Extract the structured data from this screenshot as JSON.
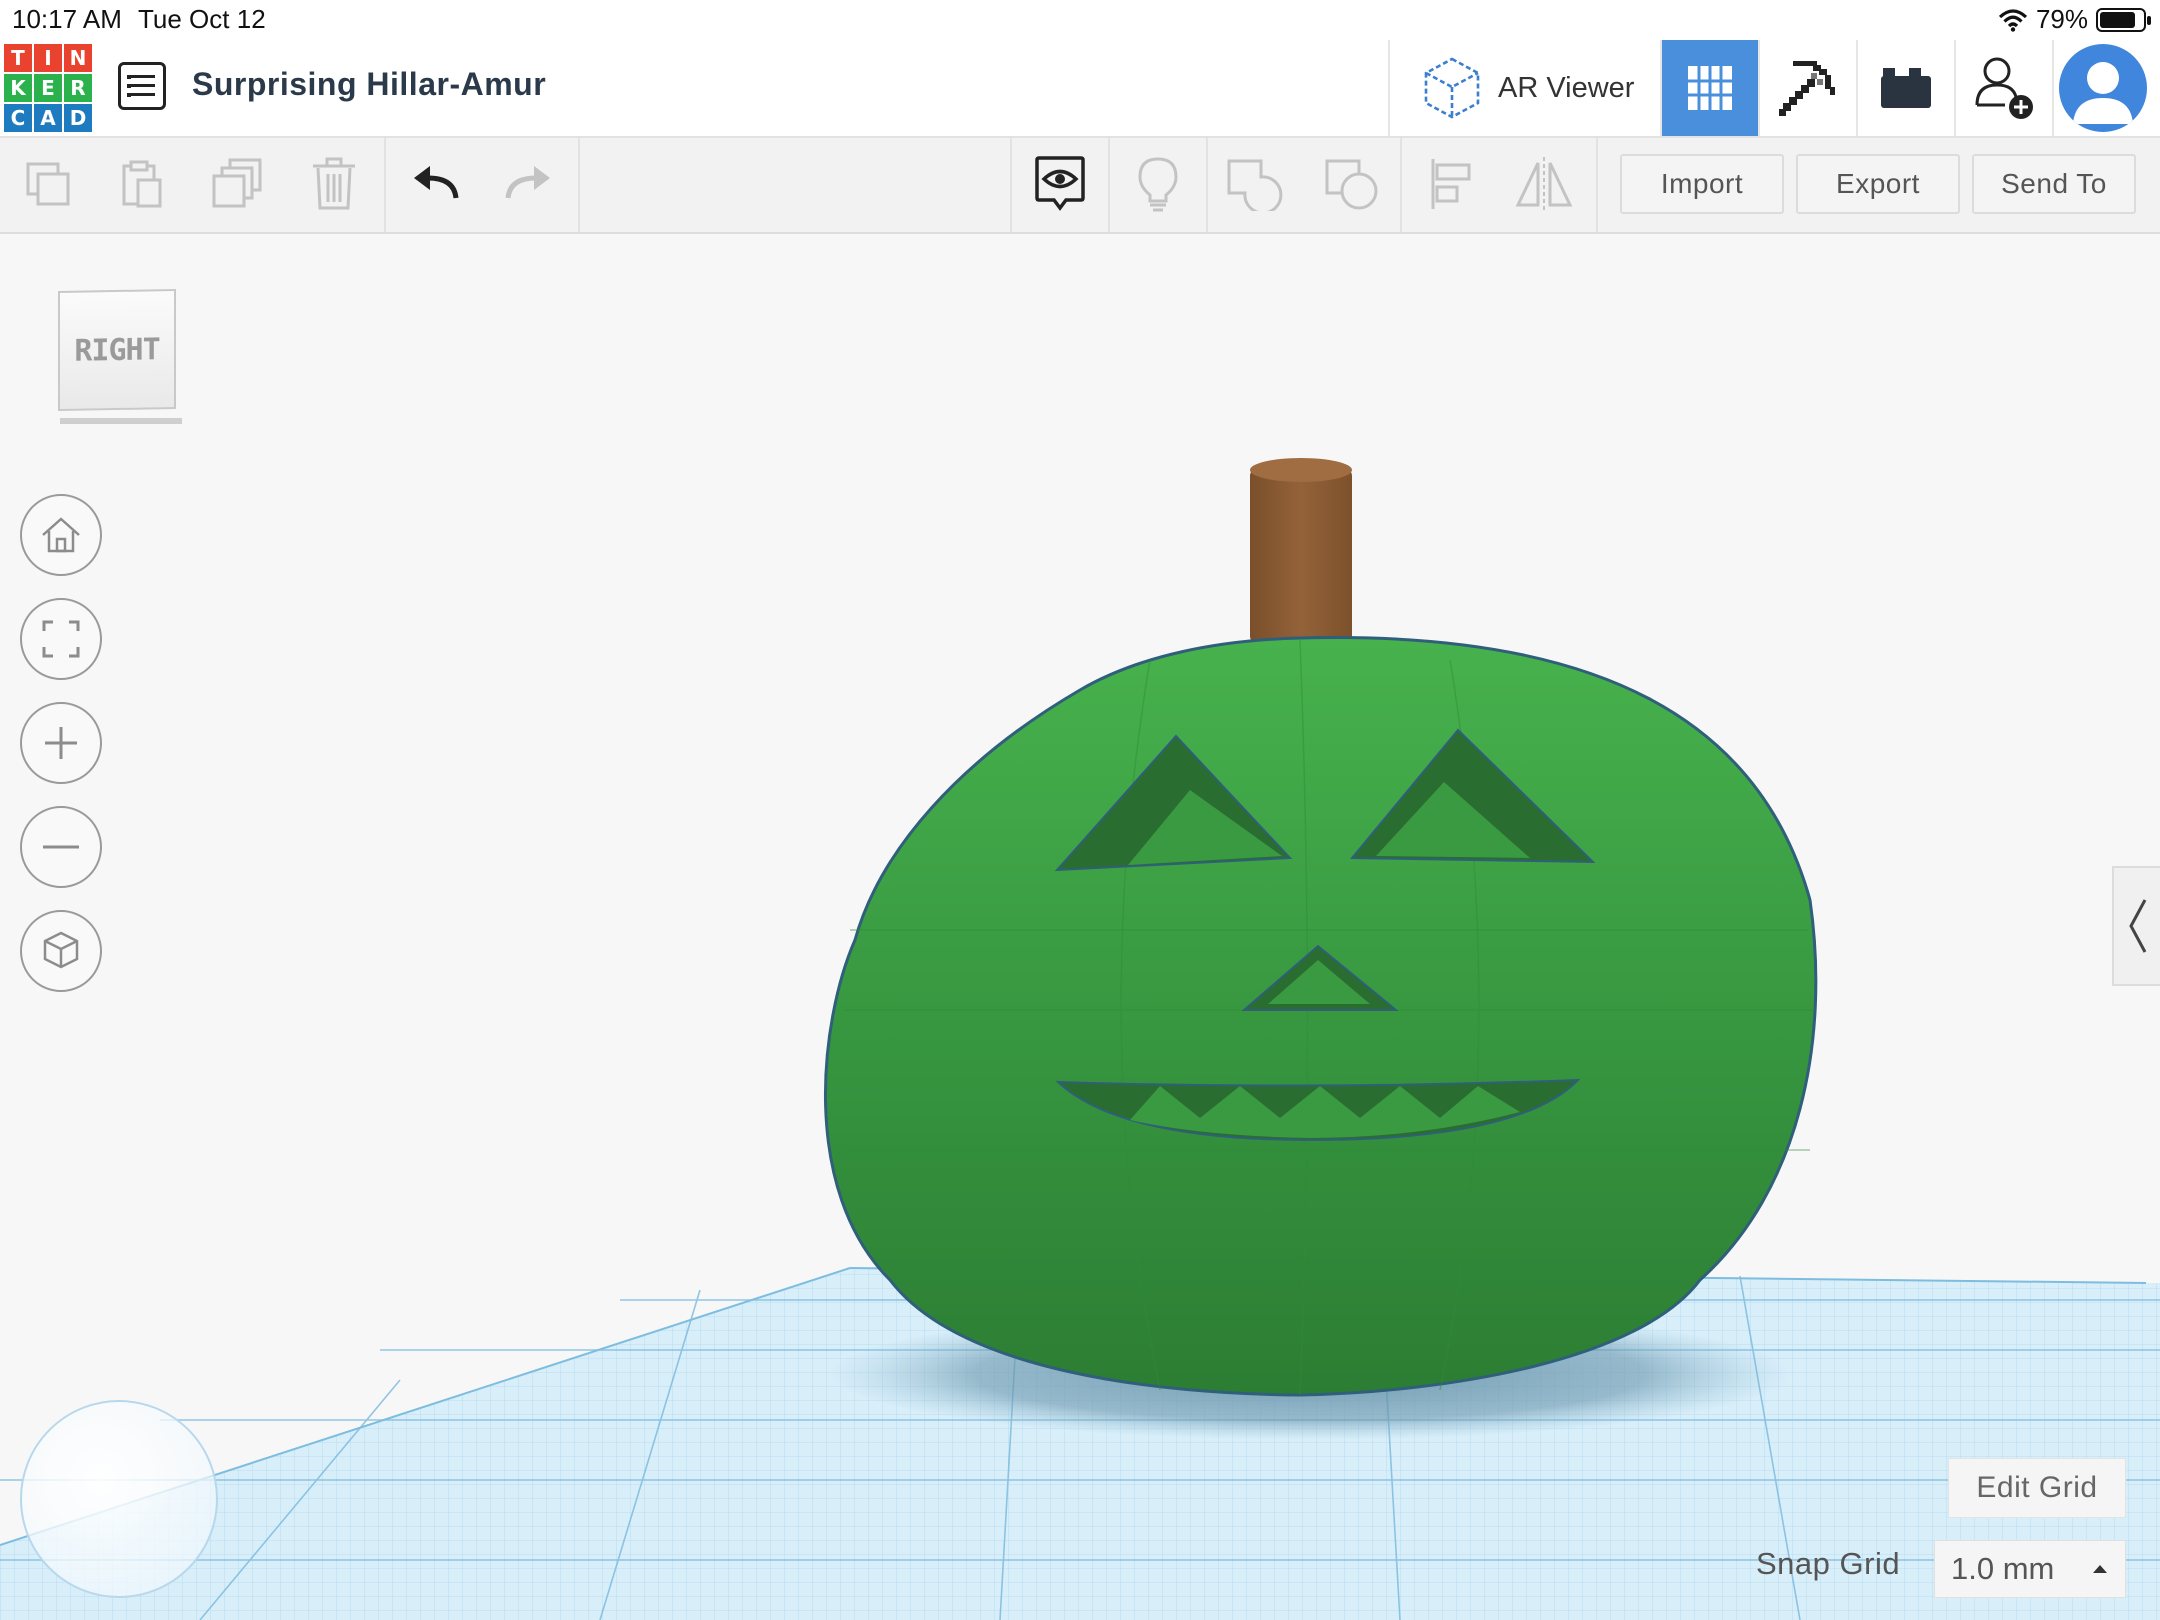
{
  "status_bar": {
    "time": "10:17 AM",
    "date": "Tue Oct 12",
    "battery": "79%",
    "battery_level": 0.79,
    "wifi_icon": "wifi-icon"
  },
  "app": {
    "logo_letters": [
      "T",
      "I",
      "N",
      "K",
      "E",
      "R",
      "C",
      "A",
      "D"
    ],
    "project_title": "Surprising Hillar-Amur",
    "ar_viewer_label": "AR Viewer",
    "accent_color": "#4a8fdb"
  },
  "toolbar": {
    "icons": [
      "copy-icon",
      "paste-icon",
      "duplicate-icon",
      "delete-icon",
      "undo-icon",
      "redo-icon",
      "show-all-icon",
      "notes-light-icon",
      "group-icon",
      "ungroup-icon",
      "align-icon",
      "mirror-icon"
    ],
    "import_label": "Import",
    "export_label": "Export",
    "send_to_label": "Send To"
  },
  "viewcube": {
    "face_label": "RIGHT"
  },
  "nav_controls": [
    "home-icon",
    "fit-view-icon",
    "zoom-in-icon",
    "zoom-out-icon",
    "ortho-view-icon"
  ],
  "workplane": {
    "edit_grid_label": "Edit Grid",
    "snap_grid_label": "Snap Grid",
    "snap_grid_value": "1.0 mm",
    "grid_color": "#a9d6ef"
  },
  "model": {
    "body_color": "#3aa144",
    "stem_color": "#8a5a32"
  }
}
